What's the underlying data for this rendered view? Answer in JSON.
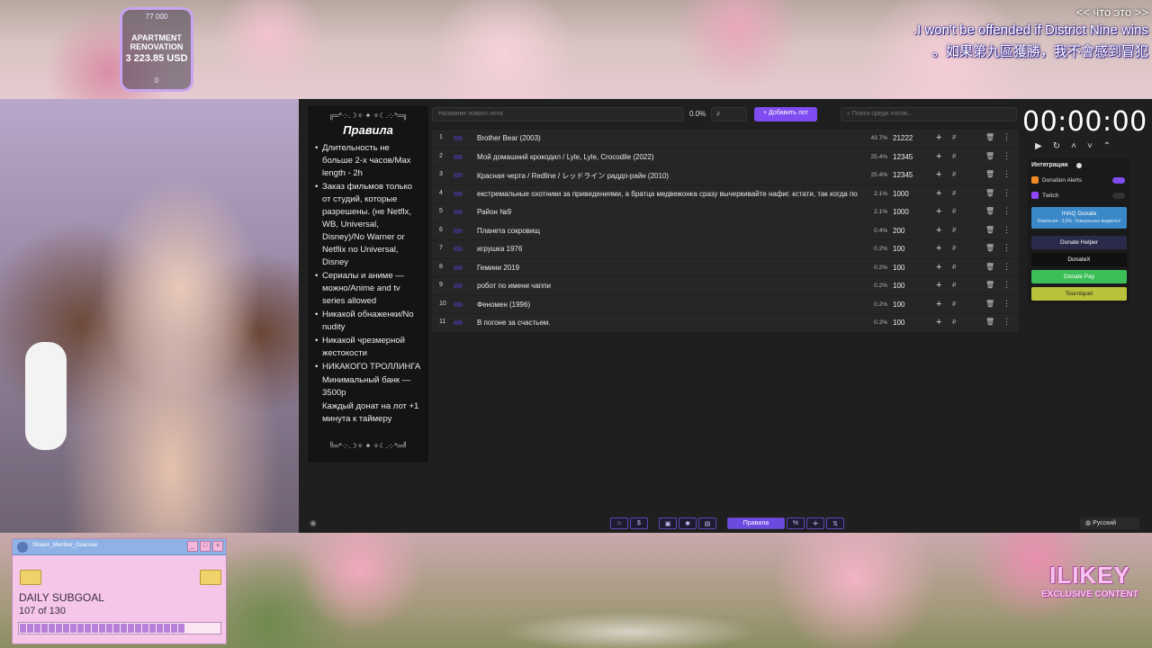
{
  "goal": {
    "top": "77 000",
    "title": "APARTMENT RENOVATION",
    "amount": "3 223.85 USD",
    "bottom": "0"
  },
  "subtitles": {
    "nav": "<< что это >>",
    "english": ".I won't be offended if District Nine wins",
    "chinese": "。如果第九區獲勝，我不會感到冒犯"
  },
  "rules": {
    "deco_top": "╔═*·:·.☽✧ ✦ ✧☾.·:·*═╗",
    "title": "Правила",
    "items": [
      {
        "text": "Длительность не больше 2-х часов/Max length - 2h",
        "bullet": true
      },
      {
        "text": "Заказ фильмов только от студий, которые разрешены. (не Netflx, WB, Universal, Disney)/No Warner or Netflix no Universal, Disney",
        "bullet": true
      },
      {
        "text": "Сериалы и аниме — можно/Anime and tv series allowed",
        "bullet": true
      },
      {
        "text": "Никакой обнаженки/No nudity",
        "bullet": true
      },
      {
        "text": "Никакой чрезмерной жестокости",
        "bullet": true
      },
      {
        "text": "НИКАКОГО ТРОЛЛИНГА",
        "bullet": true
      },
      {
        "text": "Минимальный банк — 3500р",
        "bullet": false
      },
      {
        "text": "Каждый донат на лот +1 минута к таймеру",
        "bullet": false
      }
    ],
    "deco_bottom": "╚═*·:·.☽✧ ✦ ✧☾.·:·*═╝"
  },
  "toolbar": {
    "name_placeholder": "Название нового лота",
    "percent": "0.0%",
    "price_placeholder": "₽",
    "add_label": "+ Добавить лот",
    "search_placeholder": "Поиск среди лотов..."
  },
  "lots": [
    {
      "n": "1",
      "name": "Brother Bear (2003)",
      "pct": "43.7%",
      "amount": "21222"
    },
    {
      "n": "2",
      "name": "Мой домашний крокодил / Lyle, Lyle, Crocodile (2022)",
      "pct": "25.4%",
      "amount": "12345"
    },
    {
      "n": "3",
      "name": "Красная черта / Redline / レッドライン раддо-райн (2010)",
      "pct": "25.4%",
      "amount": "12345"
    },
    {
      "n": "4",
      "name": "екстремальные охотники за привидениями, а братца медвежонка сразу вычеркивайте нафиг. кстати, так когда по",
      "pct": "2.1%",
      "amount": "1000"
    },
    {
      "n": "5",
      "name": "Район №9",
      "pct": "2.1%",
      "amount": "1000"
    },
    {
      "n": "6",
      "name": "Планета сокровищ",
      "pct": "0.4%",
      "amount": "200"
    },
    {
      "n": "7",
      "name": "игрушка 1976",
      "pct": "0.2%",
      "amount": "100"
    },
    {
      "n": "8",
      "name": "Гемини 2019",
      "pct": "0.2%",
      "amount": "100"
    },
    {
      "n": "9",
      "name": "робот по имени чаппи",
      "pct": "0.2%",
      "amount": "100"
    },
    {
      "n": "10",
      "name": "Феномен (1996)",
      "pct": "0.2%",
      "amount": "100"
    },
    {
      "n": "11",
      "name": "В погоне за счастьем.",
      "pct": "0.2%",
      "amount": "100"
    }
  ],
  "lot_icons": {
    "add": "+",
    "currency": "₽",
    "delete": "🗑",
    "more": "⋮"
  },
  "timer": {
    "value": "00:00:00"
  },
  "integrations": {
    "title": "Интеграции",
    "donation_alerts": "Donation Alerts",
    "twitch": "Twitch",
    "ihaq": "IHAQ Donate",
    "ihaq_sub": "Комиссия - 3,5%. Уникальные виджеты!",
    "donate_helper": "Donate Helper",
    "donatex": "DonateX",
    "donate_pay": "Donate Pay",
    "tourniquet": "Tourniquet"
  },
  "bottombar": {
    "rules_label": "Правила",
    "language": "Русский"
  },
  "subgoal": {
    "window_title": "Stream_Member_Goal.exe",
    "title": "DAILY SUBGOAL",
    "count": "107 of 130",
    "progress": 0.823
  },
  "branding": {
    "big": "ILIKEY",
    "small": "EXCLUSIVE CONTENT"
  },
  "colors": {
    "accent": "#7e4cf0",
    "panel": "#1f1f1f",
    "row": "#262626"
  }
}
